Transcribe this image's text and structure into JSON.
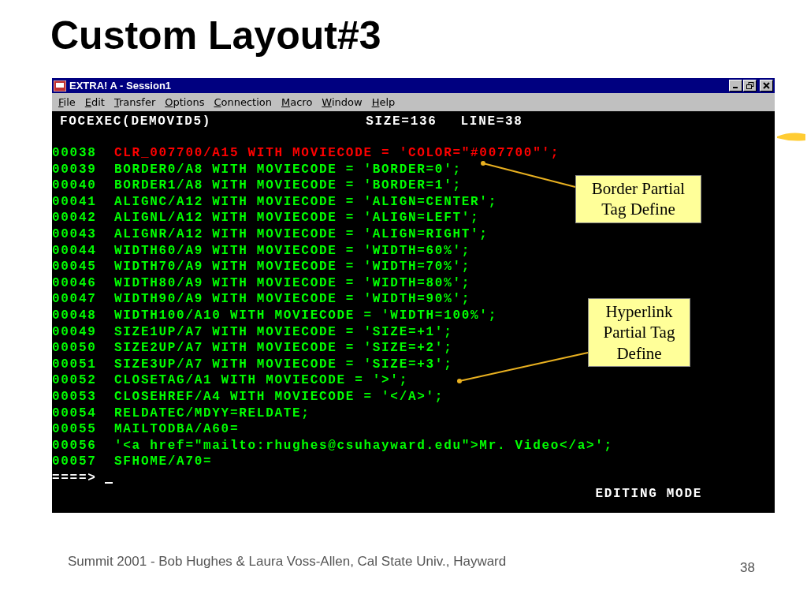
{
  "slide": {
    "title": "Custom Layout#3",
    "window": {
      "title": "EXTRA! A - Session1",
      "menu": [
        "File",
        "Edit",
        "Transfer",
        "Options",
        "Connection",
        "Macro",
        "Window",
        "Help"
      ],
      "terminal": {
        "file": "FOCEXEC(DEMOVID5)",
        "size": "SIZE=136",
        "line": "LINE=38",
        "lines": [
          {
            "number": "00038",
            "code": "CLR_007700/A15 WITH MOVIECODE = 'COLOR=\"#007700\"';",
            "highlighted": true
          },
          {
            "number": "00039",
            "code": "BORDER0/A8 WITH MOVIECODE = 'BORDER=0';",
            "highlighted": false
          },
          {
            "number": "00040",
            "code": "BORDER1/A8 WITH MOVIECODE = 'BORDER=1';",
            "highlighted": false
          },
          {
            "number": "00041",
            "code": "ALIGNC/A12 WITH MOVIECODE = 'ALIGN=CENTER';",
            "highlighted": false
          },
          {
            "number": "00042",
            "code": "ALIGNL/A12 WITH MOVIECODE = 'ALIGN=LEFT';",
            "highlighted": false
          },
          {
            "number": "00043",
            "code": "ALIGNR/A12 WITH MOVIECODE = 'ALIGN=RIGHT';",
            "highlighted": false
          },
          {
            "number": "00044",
            "code": "WIDTH60/A9 WITH MOVIECODE = 'WIDTH=60%';",
            "highlighted": false
          },
          {
            "number": "00045",
            "code": "WIDTH70/A9 WITH MOVIECODE = 'WIDTH=70%';",
            "highlighted": false
          },
          {
            "number": "00046",
            "code": "WIDTH80/A9 WITH MOVIECODE = 'WIDTH=80%';",
            "highlighted": false
          },
          {
            "number": "00047",
            "code": "WIDTH90/A9 WITH MOVIECODE = 'WIDTH=90%';",
            "highlighted": false
          },
          {
            "number": "00048",
            "code": "WIDTH100/A10 WITH MOVIECODE = 'WIDTH=100%';",
            "highlighted": false
          },
          {
            "number": "00049",
            "code": "SIZE1UP/A7 WITH MOVIECODE = 'SIZE=+1';",
            "highlighted": false
          },
          {
            "number": "00050",
            "code": "SIZE2UP/A7 WITH MOVIECODE = 'SIZE=+2';",
            "highlighted": false
          },
          {
            "number": "00051",
            "code": "SIZE3UP/A7 WITH MOVIECODE = 'SIZE=+3';",
            "highlighted": false
          },
          {
            "number": "00052",
            "code": "CLOSETAG/A1 WITH MOVIECODE = '>';",
            "highlighted": false
          },
          {
            "number": "00053",
            "code": "CLOSEHREF/A4 WITH MOVIECODE = '</A>';",
            "highlighted": false
          },
          {
            "number": "00054",
            "code": "RELDATEC/MDYY=RELDATE;",
            "highlighted": false
          },
          {
            "number": "00055",
            "code": "MAILTODBA/A60=",
            "highlighted": false
          },
          {
            "number": "00056",
            "code": "'<a href=\"mailto:rhughes@csuhayward.edu\">Mr. Video</a>';",
            "highlighted": false
          },
          {
            "number": "00057",
            "code": "SFHOME/A70=",
            "highlighted": false
          }
        ],
        "prompt": "====>",
        "mode": "EDITING MODE"
      },
      "callouts": [
        "Border Partial Tag Define",
        "Hyperlink Partial Tag Define"
      ]
    },
    "footer": "Summit 2001 - Bob Hughes & Laura Voss-Allen, Cal State Univ., Hayward",
    "page_number": "38"
  }
}
